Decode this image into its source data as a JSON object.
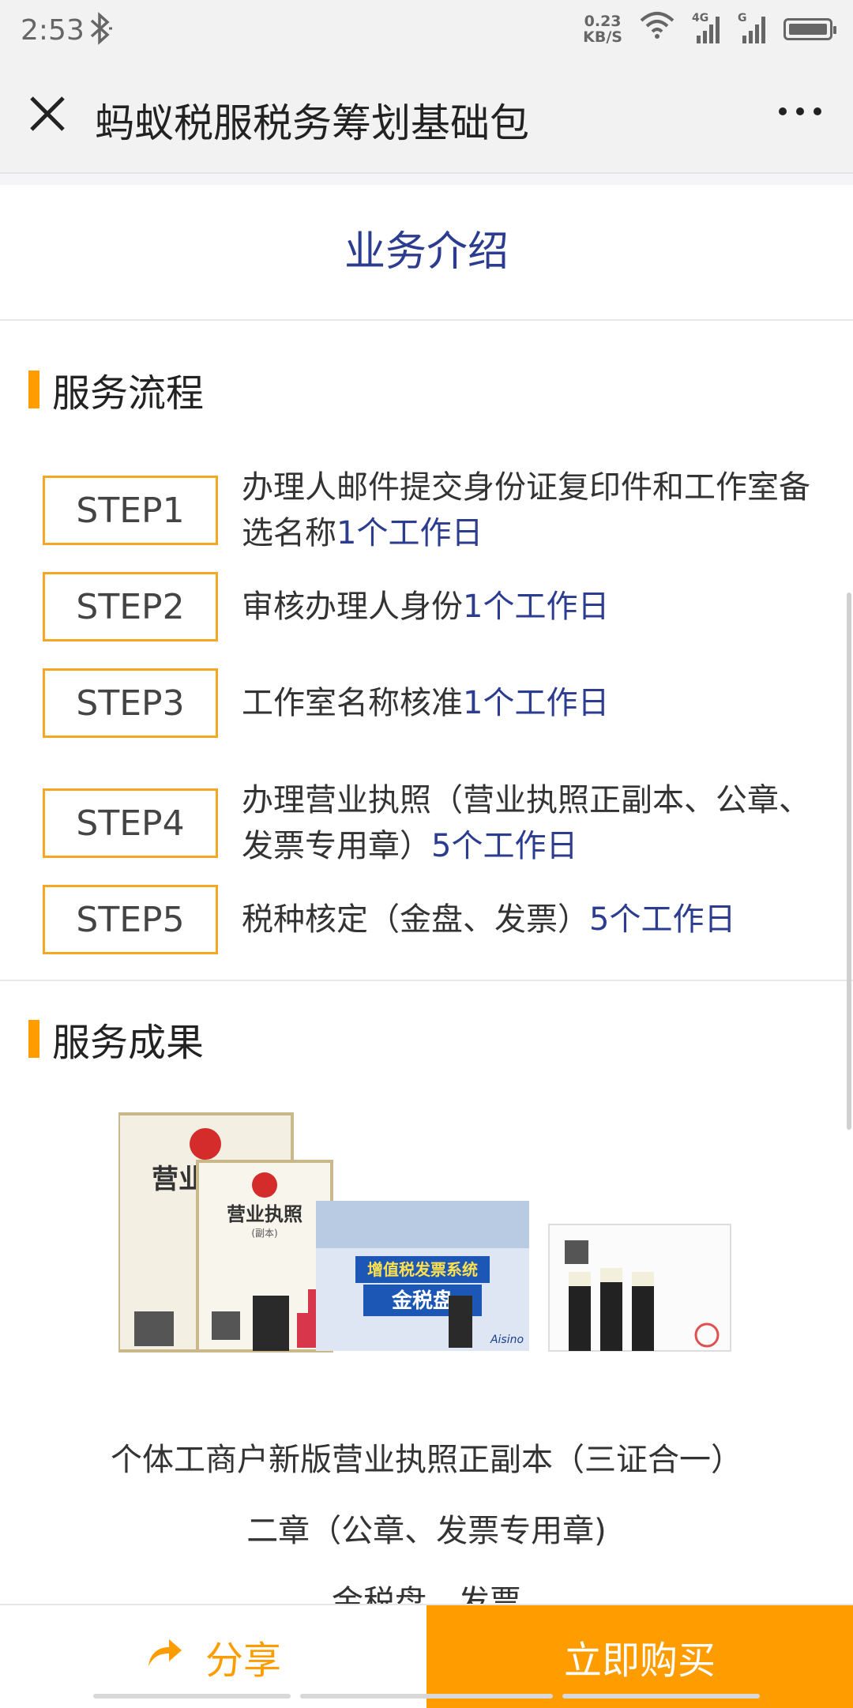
{
  "status": {
    "time": "2:53",
    "net_speed_value": "0.23",
    "net_speed_unit": "KB/S",
    "net_type": "4G",
    "net_type2": "G"
  },
  "header": {
    "title": "蚂蚁税服税务筹划基础包"
  },
  "intro": {
    "title": "业务介绍"
  },
  "process": {
    "heading": "服务流程",
    "steps": [
      {
        "label": "STEP1",
        "text": "办理人邮件提交身份证复印件和工作室备选名称",
        "days": "1个工作日"
      },
      {
        "label": "STEP2",
        "text": "审核办理人身份",
        "days": "1个工作日"
      },
      {
        "label": "STEP3",
        "text": "工作室名称核准",
        "days": "1个工作日"
      },
      {
        "label": "STEP4",
        "text": "办理营业执照（营业执照正副本、公章、发票专用章）",
        "days": "5个工作日"
      },
      {
        "label": "STEP5",
        "text": "税种核定（金盘、发票）",
        "days": "5个工作日"
      }
    ]
  },
  "results": {
    "heading": "服务成果",
    "image": {
      "license_title": "营业执照",
      "license_sub": "(副本)",
      "box_banner": "增值税发票系统",
      "box_name": "金税盘",
      "box_brand": "Aisino"
    },
    "lines": [
      "个体工商户新版营业执照正副本（三证合一）",
      "二章（公章、发票专用章)",
      "金税盘、发票"
    ]
  },
  "bottom": {
    "share_label": "分享",
    "buy_label": "立即购买"
  },
  "colors": {
    "accent": "#ff9d00",
    "step_border": "#f5a623",
    "navy": "#2c3d8f"
  }
}
